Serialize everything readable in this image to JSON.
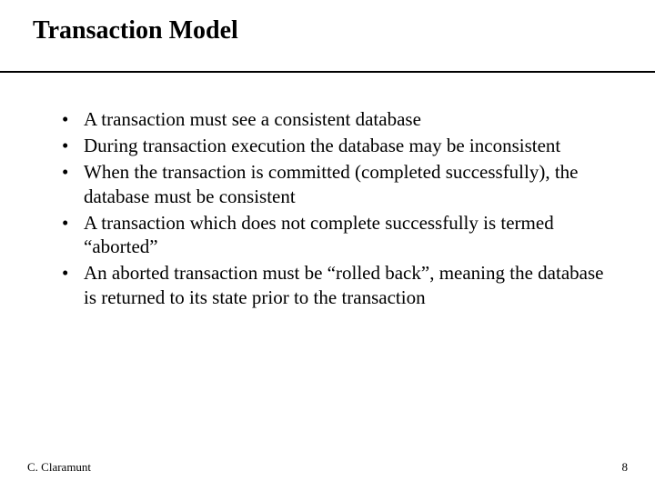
{
  "title": "Transaction Model",
  "bullets": [
    "A transaction must see a consistent database",
    "During transaction execution the database may be inconsistent",
    "When the transaction is committed (completed successfully), the database must be consistent",
    "A transaction which does not complete successfully is termed “aborted”",
    "An aborted transaction must be “rolled back”, meaning the database is returned to its state prior to the transaction"
  ],
  "footer": {
    "author": "C. Claramunt",
    "page": "8"
  }
}
